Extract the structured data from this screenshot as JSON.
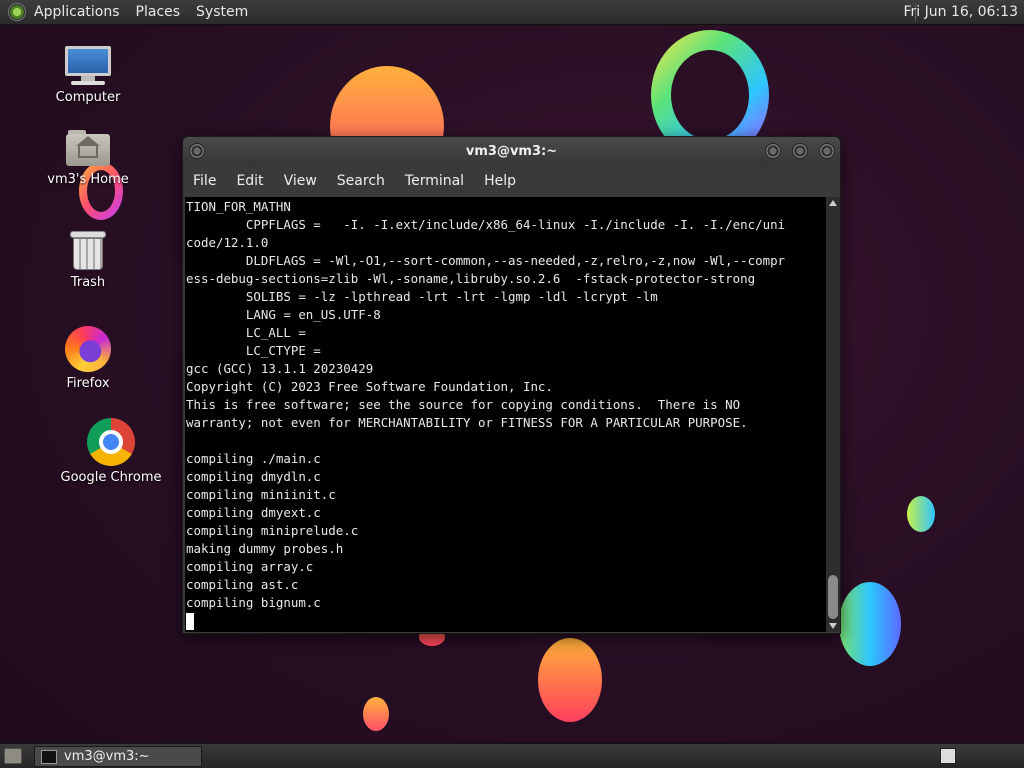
{
  "top_panel": {
    "menus": [
      "Applications",
      "Places",
      "System"
    ],
    "clock": "Fri Jun 16, 06:13"
  },
  "desktop_icons": [
    {
      "label": "Computer",
      "icon": "computer-icon"
    },
    {
      "label": "vm3's Home",
      "icon": "home-folder-icon"
    },
    {
      "label": "Trash",
      "icon": "trash-icon"
    },
    {
      "label": "Firefox",
      "icon": "firefox-icon"
    },
    {
      "label": "Google Chrome",
      "icon": "chrome-icon"
    }
  ],
  "terminal": {
    "title": "vm3@vm3:~",
    "menu": [
      "File",
      "Edit",
      "View",
      "Search",
      "Terminal",
      "Help"
    ],
    "lines": [
      "TION_FOR_MATHN",
      "        CPPFLAGS =   -I. -I.ext/include/x86_64-linux -I./include -I. -I./enc/uni",
      "code/12.1.0",
      "        DLDFLAGS = -Wl,-O1,--sort-common,--as-needed,-z,relro,-z,now -Wl,--compr",
      "ess-debug-sections=zlib -Wl,-soname,libruby.so.2.6  -fstack-protector-strong",
      "        SOLIBS = -lz -lpthread -lrt -lrt -lgmp -ldl -lcrypt -lm",
      "        LANG = en_US.UTF-8",
      "        LC_ALL =",
      "        LC_CTYPE =",
      "gcc (GCC) 13.1.1 20230429",
      "Copyright (C) 2023 Free Software Foundation, Inc.",
      "This is free software; see the source for copying conditions.  There is NO",
      "warranty; not even for MERCHANTABILITY or FITNESS FOR A PARTICULAR PURPOSE.",
      "",
      "compiling ./main.c",
      "compiling dmydln.c",
      "compiling miniinit.c",
      "compiling dmyext.c",
      "compiling miniprelude.c",
      "making dummy probes.h",
      "compiling array.c",
      "compiling ast.c",
      "compiling bignum.c"
    ]
  },
  "taskbar": {
    "task_label": "vm3@vm3:~"
  }
}
